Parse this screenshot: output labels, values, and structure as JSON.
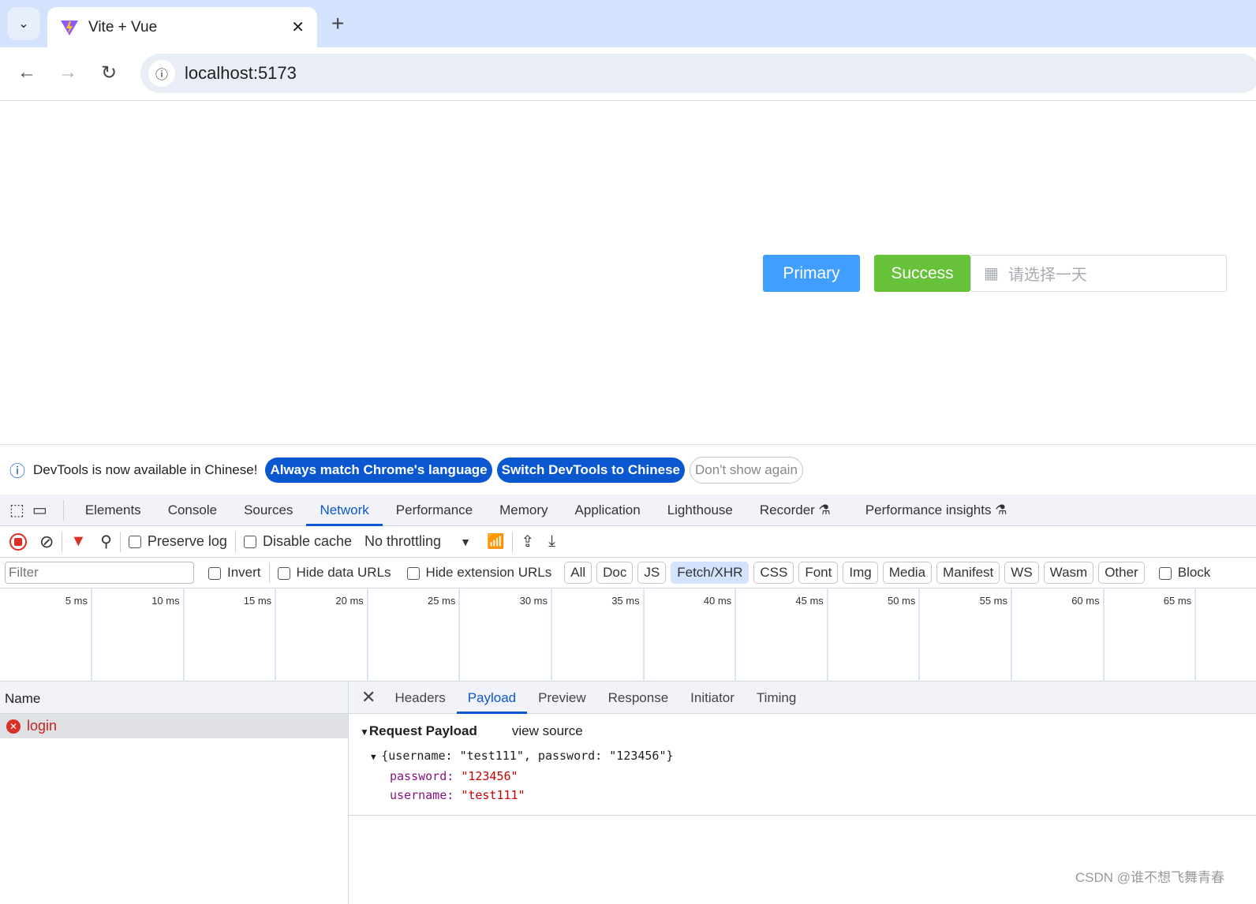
{
  "browser": {
    "tab_title": "Vite + Vue",
    "url": "localhost:5173"
  },
  "page": {
    "primary_label": "Primary",
    "success_label": "Success",
    "date_placeholder": "请选择一天",
    "colors": {
      "primary": "#409eff",
      "success": "#67c23a"
    }
  },
  "infobar": {
    "message": "DevTools is now available in Chinese!",
    "always_match": "Always match Chrome's language",
    "switch": "Switch DevTools to Chinese",
    "dont_show": "Don't show again"
  },
  "devtools": {
    "tabs": [
      "Elements",
      "Console",
      "Sources",
      "Network",
      "Performance",
      "Memory",
      "Application",
      "Lighthouse",
      "Recorder",
      "Performance insights"
    ],
    "active_tab": "Network",
    "toolbar": {
      "preserve_log": "Preserve log",
      "disable_cache": "Disable cache",
      "throttling": "No throttling"
    },
    "filter": {
      "placeholder": "Filter",
      "invert": "Invert",
      "hide_data": "Hide data URLs",
      "hide_ext": "Hide extension URLs",
      "types": [
        "All",
        "Doc",
        "JS",
        "Fetch/XHR",
        "CSS",
        "Font",
        "Img",
        "Media",
        "Manifest",
        "WS",
        "Wasm",
        "Other"
      ],
      "selected": "Fetch/XHR",
      "blocked": "Block"
    },
    "timeline_ticks": [
      "5 ms",
      "10 ms",
      "15 ms",
      "20 ms",
      "25 ms",
      "30 ms",
      "35 ms",
      "40 ms",
      "45 ms",
      "50 ms",
      "55 ms",
      "60 ms",
      "65 ms"
    ],
    "requests": {
      "header": "Name",
      "items": [
        {
          "name": "login",
          "status": "error"
        }
      ]
    },
    "detail": {
      "tabs": [
        "Headers",
        "Payload",
        "Preview",
        "Response",
        "Initiator",
        "Timing"
      ],
      "active": "Payload",
      "section": "Request Payload",
      "view_source": "view source",
      "summary": "{username: \"test111\", password: \"123456\"}",
      "fields": [
        {
          "key": "password",
          "value": "\"123456\""
        },
        {
          "key": "username",
          "value": "\"test111\""
        }
      ]
    }
  },
  "watermark": "CSDN @谁不想飞舞青春"
}
